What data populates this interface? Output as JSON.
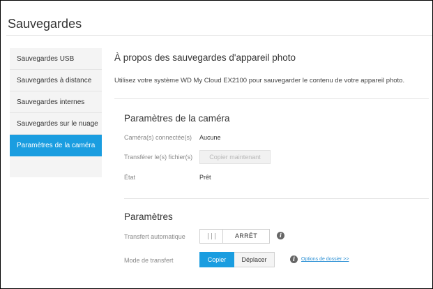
{
  "page": {
    "title": "Sauvegardes"
  },
  "sidebar": {
    "items": [
      {
        "label": "Sauvegardes USB",
        "active": false
      },
      {
        "label": "Sauvegardes à distance",
        "active": false
      },
      {
        "label": "Sauvegardes internes",
        "active": false
      },
      {
        "label": "Sauvegardes sur le nuage",
        "active": false
      },
      {
        "label": "Paramètres de la caméra",
        "active": true
      }
    ]
  },
  "about": {
    "heading": "À propos des sauvegardes d'appareil photo",
    "description": "Utilisez votre système WD My Cloud EX2100 pour sauvegarder le contenu de votre appareil photo."
  },
  "camera_settings": {
    "heading": "Paramètres de la caméra",
    "connected_label": "Caméra(s) connectée(s)",
    "connected_value": "Aucune",
    "transfer_label": "Transférer le(s) fichier(s)",
    "copy_now_button": "Copier maintenant",
    "state_label": "État",
    "state_value": "Prêt"
  },
  "settings": {
    "heading": "Paramètres",
    "auto_transfer_label": "Transfert automatique",
    "auto_transfer_state": "ARRÊT",
    "transfer_mode_label": "Mode de transfert",
    "mode_copy": "Copier",
    "mode_move": "Déplacer",
    "folder_options_link": "Options de dossier >>"
  },
  "colors": {
    "accent": "#1a9de0",
    "sidebar_bg": "#f4f4f4"
  },
  "icons": {
    "info": "info-icon"
  }
}
